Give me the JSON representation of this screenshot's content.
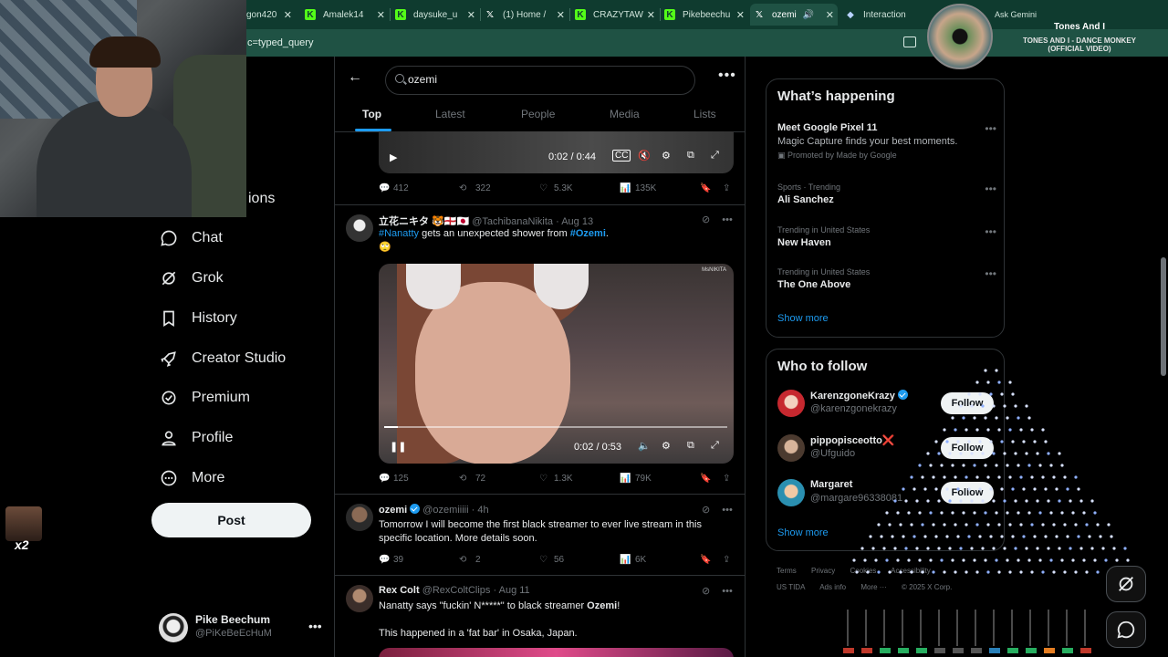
{
  "browser": {
    "tabs": [
      {
        "label": "gon420",
        "fav": "k"
      },
      {
        "label": "Amalek14",
        "fav": "k"
      },
      {
        "label": "daysuke_u",
        "fav": "k"
      },
      {
        "label": "(1) Home /",
        "fav": "x"
      },
      {
        "label": "CRAZYTAW",
        "fav": "k"
      },
      {
        "label": "Pikebeechu",
        "fav": "k"
      },
      {
        "label": "ozemi",
        "fav": "x"
      },
      {
        "label": "Interaction",
        "fav": "g"
      }
    ],
    "tab_extra": "Ask Gemini",
    "url": "c=typed_query"
  },
  "music": {
    "artist": "Tones And I",
    "song": "TONES AND I - DANCE MONKEY (OFFICIAL VIDEO)"
  },
  "nav": {
    "partial_item": "ions",
    "items": [
      {
        "label": "Chat",
        "icon": "chat-icon"
      },
      {
        "label": "Grok",
        "icon": "grok-icon"
      },
      {
        "label": "History",
        "icon": "bookmark-icon"
      },
      {
        "label": "Creator Studio",
        "icon": "rocket-icon"
      },
      {
        "label": "Premium",
        "icon": "premium-icon"
      },
      {
        "label": "Profile",
        "icon": "person-icon"
      },
      {
        "label": "More",
        "icon": "more-circle-icon"
      }
    ],
    "post_label": "Post",
    "account": {
      "name": "Pike Beechum",
      "handle": "@PiKeBeEcHuM"
    },
    "badge": "x2"
  },
  "search": {
    "query": "ozemi"
  },
  "tabs": [
    "Top",
    "Latest",
    "People",
    "Media",
    "Lists"
  ],
  "tweet1": {
    "time": "0:02 / 0:44",
    "stats": {
      "replies": "412",
      "reposts": "322",
      "likes": "5.3K",
      "views": "135K"
    }
  },
  "tweet2": {
    "name": "立花ニキタ 🐯🏴󠁧󠁢󠁥󠁮󠁧󠁿🇯🇵",
    "handle": "@TachibanaNikita",
    "date": "Aug 13",
    "hashtag1": "#Nanatty",
    "text_mid": " gets an unexpected shower from ",
    "hashtag2": "#Ozemi",
    "text_end": ".",
    "emoji": "🙄",
    "watermark": "MsNIKITA",
    "time": "0:02 / 0:53",
    "progress": 0.04,
    "stats": {
      "replies": "125",
      "reposts": "72",
      "likes": "1.3K",
      "views": "79K"
    }
  },
  "tweet3": {
    "name": "ozemi",
    "handle": "@ozemiiiii",
    "date": "4h",
    "text": "Tomorrow I will become the first black streamer to ever live stream in this specific location. More details soon.",
    "stats": {
      "replies": "39",
      "reposts": "2",
      "likes": "56",
      "views": "6K"
    }
  },
  "tweet4": {
    "name": "Rex Colt",
    "handle": "@RexColtClips",
    "date": "Aug 11",
    "text_pre": "Nanatty says \"fuckin' N*****\" to black streamer ",
    "text_bold": "Ozemi",
    "text_post": "!",
    "line2": "This happened in a 'fat bar' in Osaka, Japan."
  },
  "happening": {
    "title": "What’s happening",
    "trends": [
      {
        "ctx": "",
        "title": "Meet Google Pixel 11",
        "desc": "Magic Capture finds your best moments.",
        "promo": "Promoted by Made by Google"
      },
      {
        "ctx": "Sports · Trending",
        "title": "Ali Sanchez",
        "desc": "",
        "promo": ""
      },
      {
        "ctx": "Trending in United States",
        "title": "New Haven",
        "desc": "",
        "promo": ""
      },
      {
        "ctx": "Trending in United States",
        "title": "The One Above",
        "desc": "",
        "promo": ""
      }
    ],
    "show_more": "Show more"
  },
  "who_to_follow": {
    "title": "Who to follow",
    "users": [
      {
        "name": "KarenzgoneKrazy",
        "handle": "@karenzgonekrazy",
        "verified": true,
        "follow": "Follow"
      },
      {
        "name": "pippopisceotto❌",
        "handle": "@Ufguido",
        "verified": false,
        "follow": "Follow"
      },
      {
        "name": "Margaret",
        "handle": "@margare96338081",
        "verified": false,
        "follow": "Follow"
      }
    ],
    "show_more": "Show more"
  },
  "footer": {
    "row1": [
      "Terms",
      "Privacy",
      "Cookies",
      "Accessibility"
    ],
    "row2": [
      "US TIDA",
      "Ads info",
      "More ···",
      "© 2025 X Corp."
    ]
  },
  "colors": {
    "accent": "#1d9bf0",
    "bg": "#000000",
    "border": "#2f3336",
    "browser": "#1f5244"
  }
}
